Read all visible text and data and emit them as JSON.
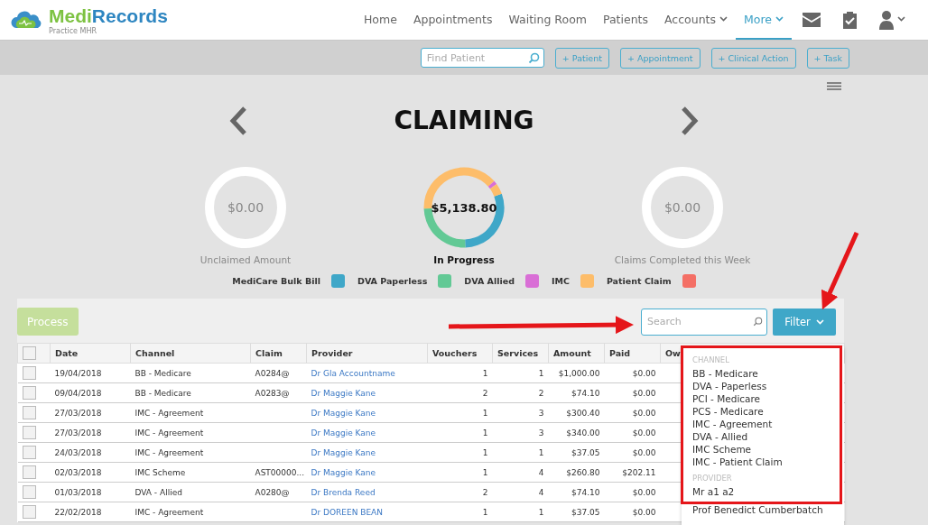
{
  "brand": {
    "name_a": "Medi",
    "name_b": "Records",
    "subtitle": "Practice MHR"
  },
  "nav": [
    {
      "label": "Home",
      "selected": false,
      "dropdown": false
    },
    {
      "label": "Appointments",
      "selected": false,
      "dropdown": false
    },
    {
      "label": "Waiting Room",
      "selected": false,
      "dropdown": false
    },
    {
      "label": "Patients",
      "selected": false,
      "dropdown": false
    },
    {
      "label": "Accounts",
      "selected": false,
      "dropdown": true
    },
    {
      "label": "More",
      "selected": true,
      "dropdown": true
    }
  ],
  "toolbar": {
    "search_placeholder": "Find Patient",
    "buttons": [
      "+ Patient",
      "+ Appointment",
      "+ Clinical Action",
      "+ Task"
    ]
  },
  "page_title": "CLAIMING",
  "summaries": [
    {
      "amount": "$0.00",
      "label": "Unclaimed Amount",
      "active": false
    },
    {
      "amount": "$5,138.80",
      "label": "In Progress",
      "active": true
    },
    {
      "amount": "$0.00",
      "label": "Claims Completed this Week",
      "active": false
    }
  ],
  "legend": [
    {
      "label": "MediCare Bulk Bill",
      "color": "#3fa7c8"
    },
    {
      "label": "DVA Paperless",
      "color": "#62c995"
    },
    {
      "label": "DVA Allied",
      "color": "#d96fd6"
    },
    {
      "label": "IMC",
      "color": "#fdbd6a"
    },
    {
      "label": "Patient Claim",
      "color": "#f46f65"
    }
  ],
  "process_button": {
    "label": "Process",
    "disabled": true
  },
  "search": {
    "placeholder": "Search"
  },
  "filter_button": "Filter",
  "table": {
    "all_checked": false,
    "columns": [
      "Date",
      "Channel",
      "Claim",
      "Provider",
      "Vouchers",
      "Services",
      "Amount",
      "Paid",
      "Ow"
    ],
    "rows": [
      {
        "checked": false,
        "cells": [
          "19/04/2018",
          "BB - Medicare",
          "A0284@",
          "Dr Gla Accountname",
          "1",
          "1",
          "$1,000.00",
          "$0.00"
        ]
      },
      {
        "checked": false,
        "cells": [
          "09/04/2018",
          "BB - Medicare",
          "A0283@",
          "Dr Maggie Kane",
          "2",
          "2",
          "$74.10",
          "$0.00"
        ]
      },
      {
        "checked": false,
        "cells": [
          "27/03/2018",
          "IMC - Agreement",
          "",
          "Dr Maggie Kane",
          "1",
          "3",
          "$300.40",
          "$0.00"
        ]
      },
      {
        "checked": false,
        "cells": [
          "27/03/2018",
          "IMC - Agreement",
          "",
          "Dr Maggie Kane",
          "1",
          "3",
          "$340.00",
          "$0.00"
        ]
      },
      {
        "checked": false,
        "cells": [
          "24/03/2018",
          "IMC - Agreement",
          "",
          "Dr Maggie Kane",
          "1",
          "1",
          "$37.05",
          "$0.00"
        ]
      },
      {
        "checked": false,
        "cells": [
          "02/03/2018",
          "IMC Scheme",
          "AST00000...",
          "Dr Maggie Kane",
          "1",
          "4",
          "$260.80",
          "$202.11"
        ]
      },
      {
        "checked": false,
        "cells": [
          "01/03/2018",
          "DVA - Allied",
          "A0280@",
          "Dr Brenda Reed",
          "2",
          "4",
          "$74.10",
          "$0.00"
        ]
      },
      {
        "checked": false,
        "cells": [
          "22/02/2018",
          "IMC - Agreement",
          "",
          "Dr DOREEN BEAN",
          "1",
          "1",
          "$37.05",
          "$0.00"
        ]
      }
    ]
  },
  "filter_menu": {
    "sections": [
      {
        "heading": "CHANNEL",
        "items": [
          "BB - Medicare",
          "DVA - Paperless",
          "PCI - Medicare",
          "PCS - Medicare",
          "IMC - Agreement",
          "DVA - Allied",
          "IMC Scheme",
          "IMC - Patient Claim"
        ]
      },
      {
        "heading": "PROVIDER",
        "items": [
          "Mr a1 a2",
          "Prof Benedict Cumberbatch"
        ]
      }
    ]
  }
}
